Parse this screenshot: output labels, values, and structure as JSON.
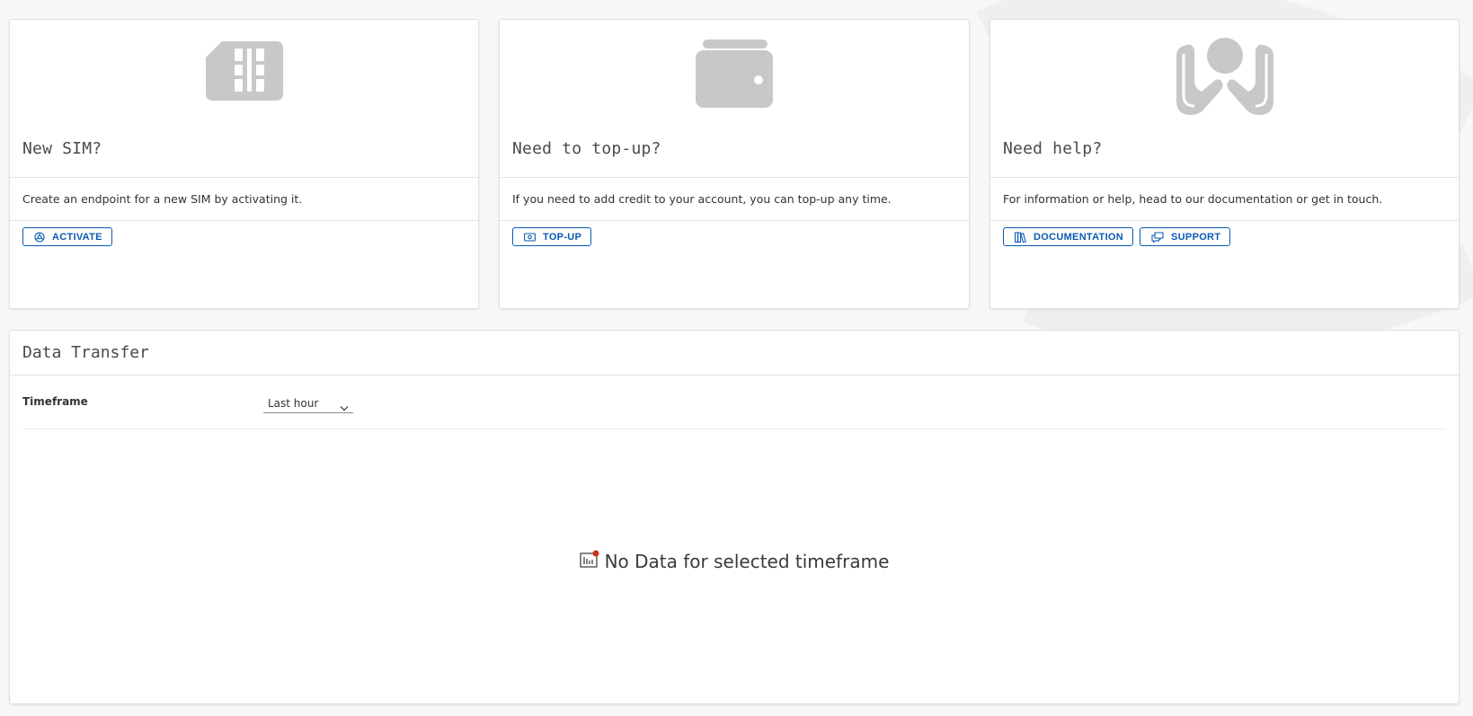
{
  "cards": [
    {
      "icon": "sim-card-icon",
      "title": "New SIM?",
      "description": "Create an endpoint for a new SIM by activating it.",
      "actions": [
        {
          "label": "ACTIVATE",
          "icon": "activate-icon"
        }
      ]
    },
    {
      "icon": "wallet-icon",
      "title": "Need to top-up?",
      "description": "If you need to add credit to your account, you can top-up any time.",
      "actions": [
        {
          "label": "TOP-UP",
          "icon": "money-icon"
        }
      ]
    },
    {
      "icon": "helping-hands-icon",
      "title": "Need help?",
      "description": "For information or help, head to our documentation or get in touch.",
      "actions": [
        {
          "label": "DOCUMENTATION",
          "icon": "books-icon"
        },
        {
          "label": "SUPPORT",
          "icon": "chat-bubbles-icon"
        }
      ]
    }
  ],
  "data_transfer": {
    "title": "Data Transfer",
    "timeframe_label": "Timeframe",
    "timeframe_value": "Last hour",
    "empty_message": "No Data for selected timeframe",
    "empty_icon": "chart-no-data-icon"
  },
  "colors": {
    "accent": "#0a5ab5",
    "icon_gray": "#c8c8c8",
    "alert_dot": "#d0301c"
  }
}
